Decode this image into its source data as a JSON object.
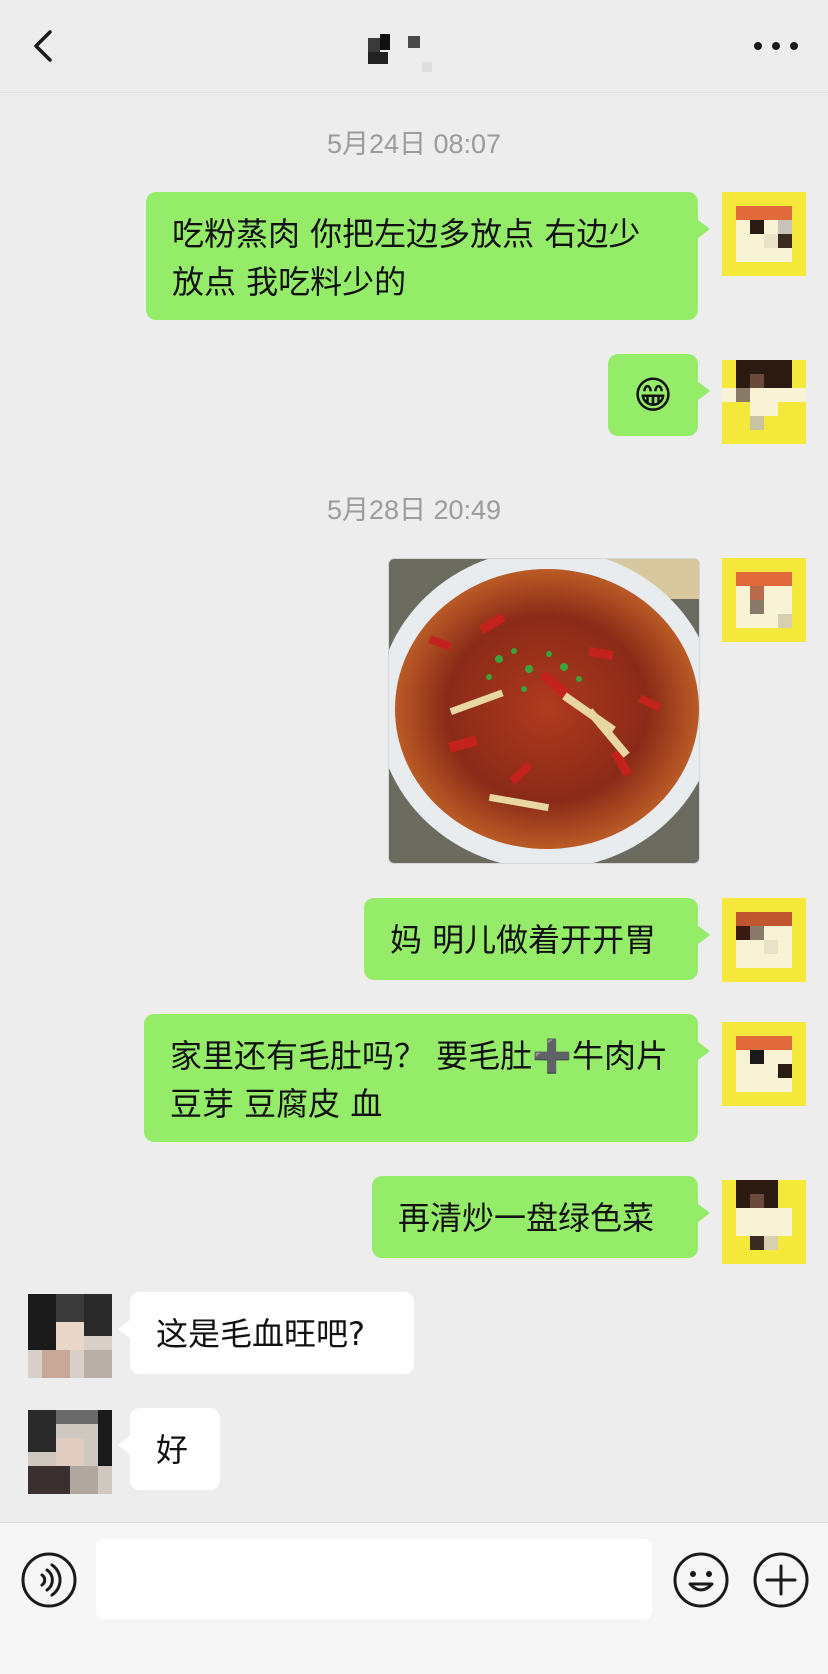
{
  "header": {
    "back_icon": "chevron-left-icon",
    "title": "",
    "more_icon": "more-dots-icon"
  },
  "chat": {
    "timestamps": [
      "5月24日 08:07",
      "5月28日 20:49"
    ],
    "messages": [
      {
        "sender": "me",
        "type": "text",
        "text": "吃粉蒸肉 你把左边多放点 右边少放点 我吃料少的"
      },
      {
        "sender": "me",
        "type": "emoji",
        "icon": "grinning-emoji-icon",
        "text": "😁"
      },
      {
        "sender": "me",
        "type": "image",
        "icon": "food-photo-icon"
      },
      {
        "sender": "me",
        "type": "text",
        "text": "妈 明儿做着开开胃"
      },
      {
        "sender": "me",
        "type": "text",
        "text": "家里还有毛肚吗？ 要毛肚➕牛肉片 豆芽 豆腐皮 血"
      },
      {
        "sender": "me",
        "type": "text",
        "text": "再清炒一盘绿色菜"
      },
      {
        "sender": "other",
        "type": "text",
        "text": "这是毛血旺吧?"
      },
      {
        "sender": "other",
        "type": "text",
        "text": "好"
      }
    ]
  },
  "input_bar": {
    "voice_icon": "voice-icon",
    "emoji_icon": "emoji-icon",
    "add_icon": "plus-icon",
    "input_value": ""
  },
  "colors": {
    "background": "#ededed",
    "my_bubble": "#95ec69",
    "other_bubble": "#ffffff",
    "timestamp": "#9b9b9b"
  }
}
